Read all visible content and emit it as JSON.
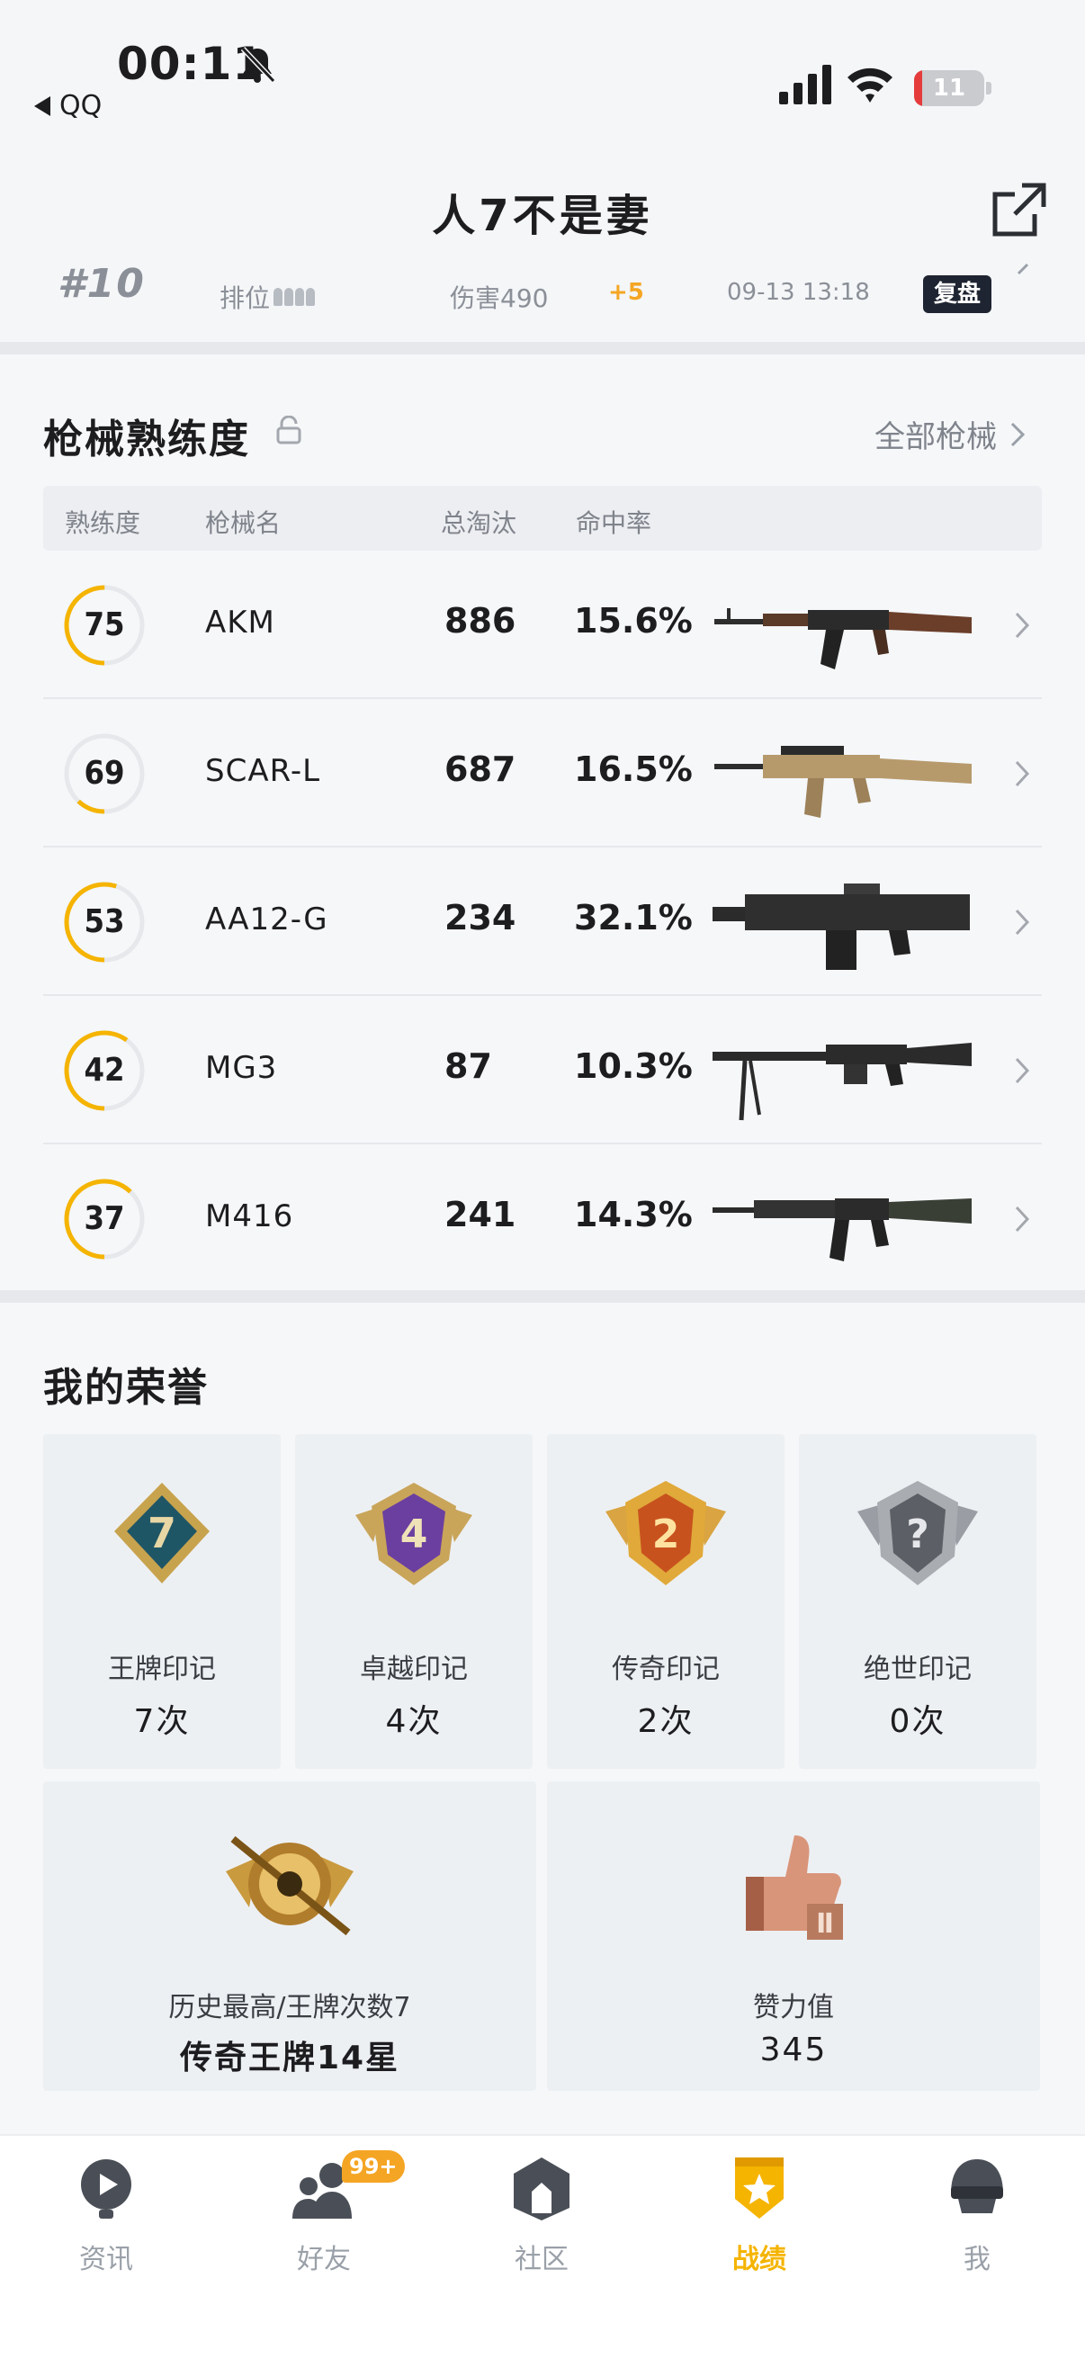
{
  "status_bar": {
    "time": "00:11",
    "back_app": "QQ",
    "battery_level": "11",
    "battery_fraction": 0.11
  },
  "header": {
    "title": "人7不是妻"
  },
  "match_row": {
    "rank": "#10",
    "mode": "排位",
    "damage": "伤害490",
    "score_change": "+5",
    "date": "09-13 13:18",
    "replay": "复盘"
  },
  "mastery": {
    "title": "枪械熟练度",
    "all_link": "全部枪械",
    "columns": {
      "level": "熟练度",
      "name": "枪械名",
      "kills": "总淘汰",
      "hit_rate": "命中率"
    },
    "rows": [
      {
        "level": "75",
        "progress": 0.5,
        "name": "AKM",
        "kills": "886",
        "hit_rate": "15.6%"
      },
      {
        "level": "69",
        "progress": 0.12,
        "name": "SCAR-L",
        "kills": "687",
        "hit_rate": "16.5%"
      },
      {
        "level": "53",
        "progress": 0.55,
        "name": "AA12-G",
        "kills": "234",
        "hit_rate": "32.1%"
      },
      {
        "level": "42",
        "progress": 0.6,
        "name": "MG3",
        "kills": "87",
        "hit_rate": "10.3%"
      },
      {
        "level": "37",
        "progress": 0.62,
        "name": "M416",
        "kills": "241",
        "hit_rate": "14.3%"
      }
    ],
    "ring_color": "#f5b400"
  },
  "honors": {
    "title": "我的荣誉",
    "marks": [
      {
        "label": "王牌印记",
        "count": "7次",
        "badge_num": "7"
      },
      {
        "label": "卓越印记",
        "count": "4次",
        "badge_num": "4"
      },
      {
        "label": "传奇印记",
        "count": "2次",
        "badge_num": "2"
      },
      {
        "label": "绝世印记",
        "count": "0次",
        "badge_num": "?"
      }
    ],
    "best": {
      "label": "历史最高/王牌次数7",
      "value": "传奇王牌14星"
    },
    "likes": {
      "label": "赞力值",
      "value": "345"
    }
  },
  "bottom_nav": {
    "items": [
      {
        "label": "资讯"
      },
      {
        "label": "好友",
        "badge": "99+"
      },
      {
        "label": "社区"
      },
      {
        "label": "战绩"
      },
      {
        "label": "我"
      }
    ],
    "active_color": "#f5b400"
  }
}
